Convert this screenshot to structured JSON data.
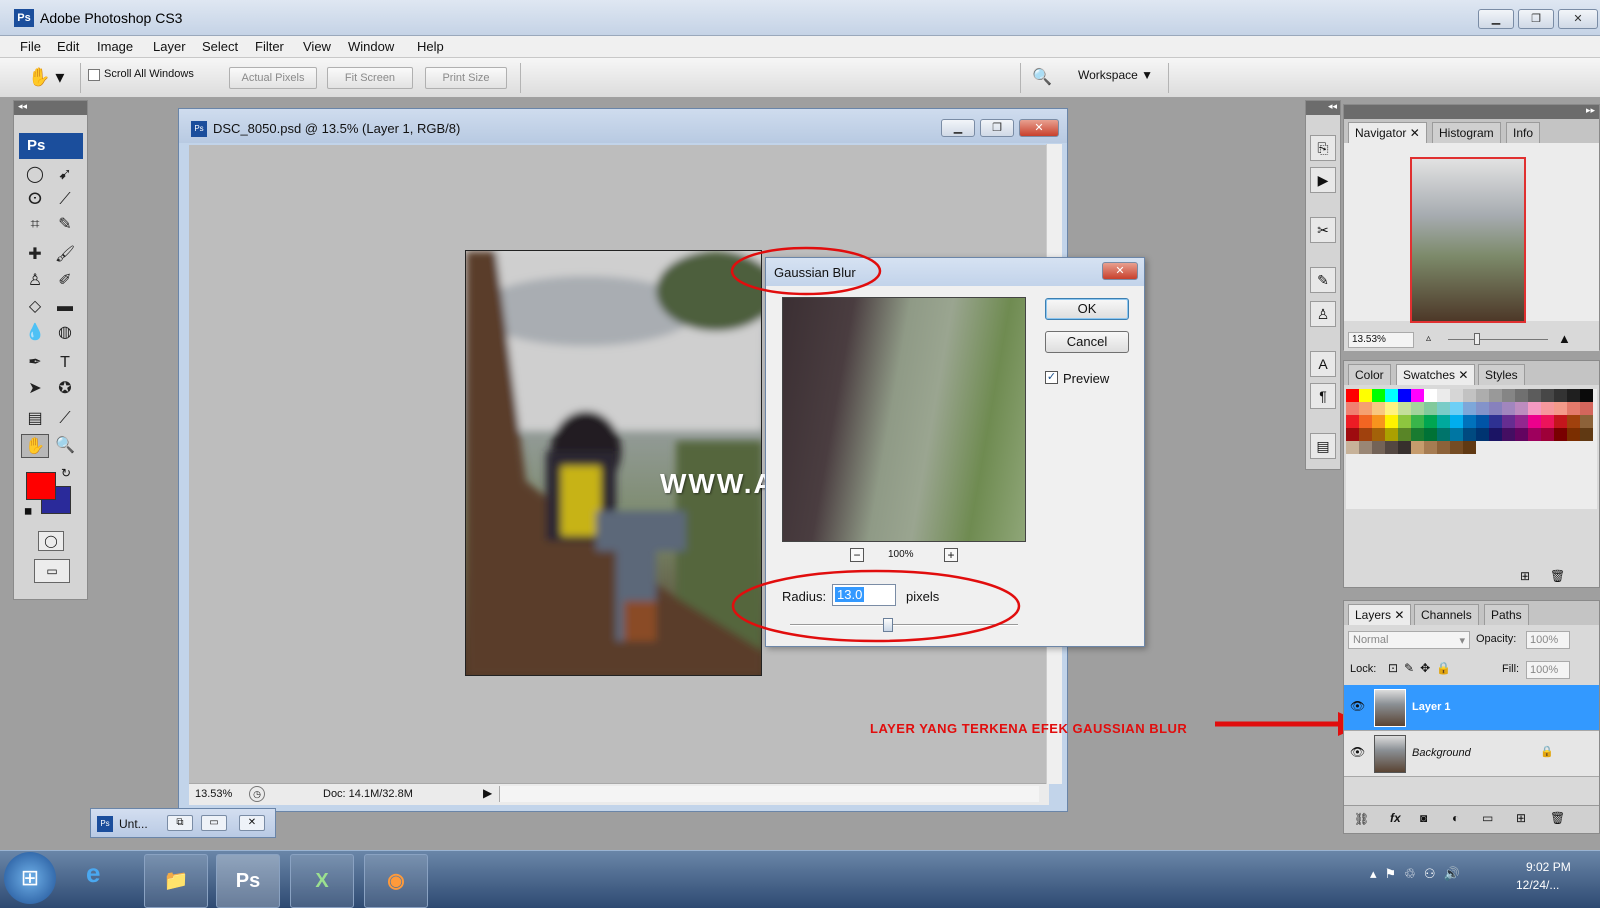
{
  "app": {
    "title": "Adobe Photoshop CS3",
    "logo": "Ps"
  },
  "menu": [
    "File",
    "Edit",
    "Image",
    "Layer",
    "Select",
    "Filter",
    "View",
    "Window",
    "Help"
  ],
  "options": {
    "scroll_all": "Scroll All Windows",
    "actual_pixels": "Actual Pixels",
    "fit_screen": "Fit Screen",
    "print_size": "Print Size",
    "workspace": "Workspace ▼"
  },
  "document": {
    "title": "DSC_8050.psd @ 13.5% (Layer 1, RGB/8)",
    "zoom": "13.53%",
    "doc_size": "Doc: 14.1M/32.8M"
  },
  "minimized_doc": {
    "label": "Unt..."
  },
  "dialog": {
    "title": "Gaussian Blur",
    "ok": "OK",
    "cancel": "Cancel",
    "preview_label": "Preview",
    "preview_checked": true,
    "preview_zoom": "100%",
    "radius_label": "Radius:",
    "radius_value": "13.0",
    "radius_unit": "pixels",
    "radius_slider_fraction": 0.43
  },
  "navigator": {
    "tabs": [
      "Navigator",
      "Histogram",
      "Info"
    ],
    "zoom": "13.53%"
  },
  "swatches": {
    "tabs": [
      "Color",
      "Swatches",
      "Styles"
    ],
    "rows": [
      [
        "#ff0000",
        "#ffff00",
        "#00ff00",
        "#00ffff",
        "#0000ff",
        "#ff00ff",
        "#ffffff",
        "#ebebeb",
        "#d6d6d6",
        "#c2c2c2",
        "#adadad",
        "#999999",
        "#858585",
        "#707070",
        "#5c5c5c",
        "#474747",
        "#333333",
        "#1f1f1f",
        "#0a0a0a"
      ],
      [
        "#f08070",
        "#f5a070",
        "#f8c880",
        "#fff380",
        "#c4df9b",
        "#a3d39c",
        "#82ca9c",
        "#7accc8",
        "#6dcff6",
        "#7da7d9",
        "#8393ca",
        "#8781bd",
        "#a186be",
        "#bd8cbf",
        "#f49ac2",
        "#f6989d",
        "#f49a8a",
        "#e47a6b",
        "#d4665c"
      ],
      [
        "#ed1c24",
        "#f26522",
        "#f7941d",
        "#fff200",
        "#8dc63f",
        "#39b54a",
        "#00a651",
        "#00a99d",
        "#00aeef",
        "#0072bc",
        "#0054a6",
        "#2e3192",
        "#662d91",
        "#92278f",
        "#ec008c",
        "#ed145b",
        "#c4161c",
        "#a0410d",
        "#8c6239"
      ],
      [
        "#9e0b0f",
        "#a0410d",
        "#a36209",
        "#aba000",
        "#598527",
        "#197b30",
        "#007236",
        "#00746b",
        "#0076a3",
        "#004a80",
        "#003471",
        "#1b1464",
        "#440e62",
        "#630460",
        "#9e005d",
        "#9e0039",
        "#790000",
        "#7b2e00",
        "#603913"
      ],
      [
        "#c7b299",
        "#998675",
        "#736357",
        "#534741",
        "#37302d",
        "#c69c6d",
        "#a67c52",
        "#8c6239",
        "#754c24",
        "#603913"
      ]
    ]
  },
  "layers_panel": {
    "tabs": [
      "Layers",
      "Channels",
      "Paths"
    ],
    "blend_mode": "Normal",
    "opacity_label": "Opacity:",
    "opacity": "100%",
    "lock_label": "Lock:",
    "fill_label": "Fill:",
    "fill": "100%",
    "layers": [
      {
        "name": "Layer 1",
        "selected": true
      },
      {
        "name": "Background",
        "selected": false,
        "locked": true
      }
    ]
  },
  "watermark": "WWW.AYOJEPRET.COM",
  "annotation": "LAYER YANG TERKENA EFEK GAUSSIAN BLUR",
  "taskbar": {
    "time": "9:02 PM",
    "date": "12/24/..."
  },
  "colors": {
    "foreground": "#ff0000",
    "background": "#2a2a9a",
    "highlight": "#3399ff",
    "annotation": "#e10d0d"
  }
}
